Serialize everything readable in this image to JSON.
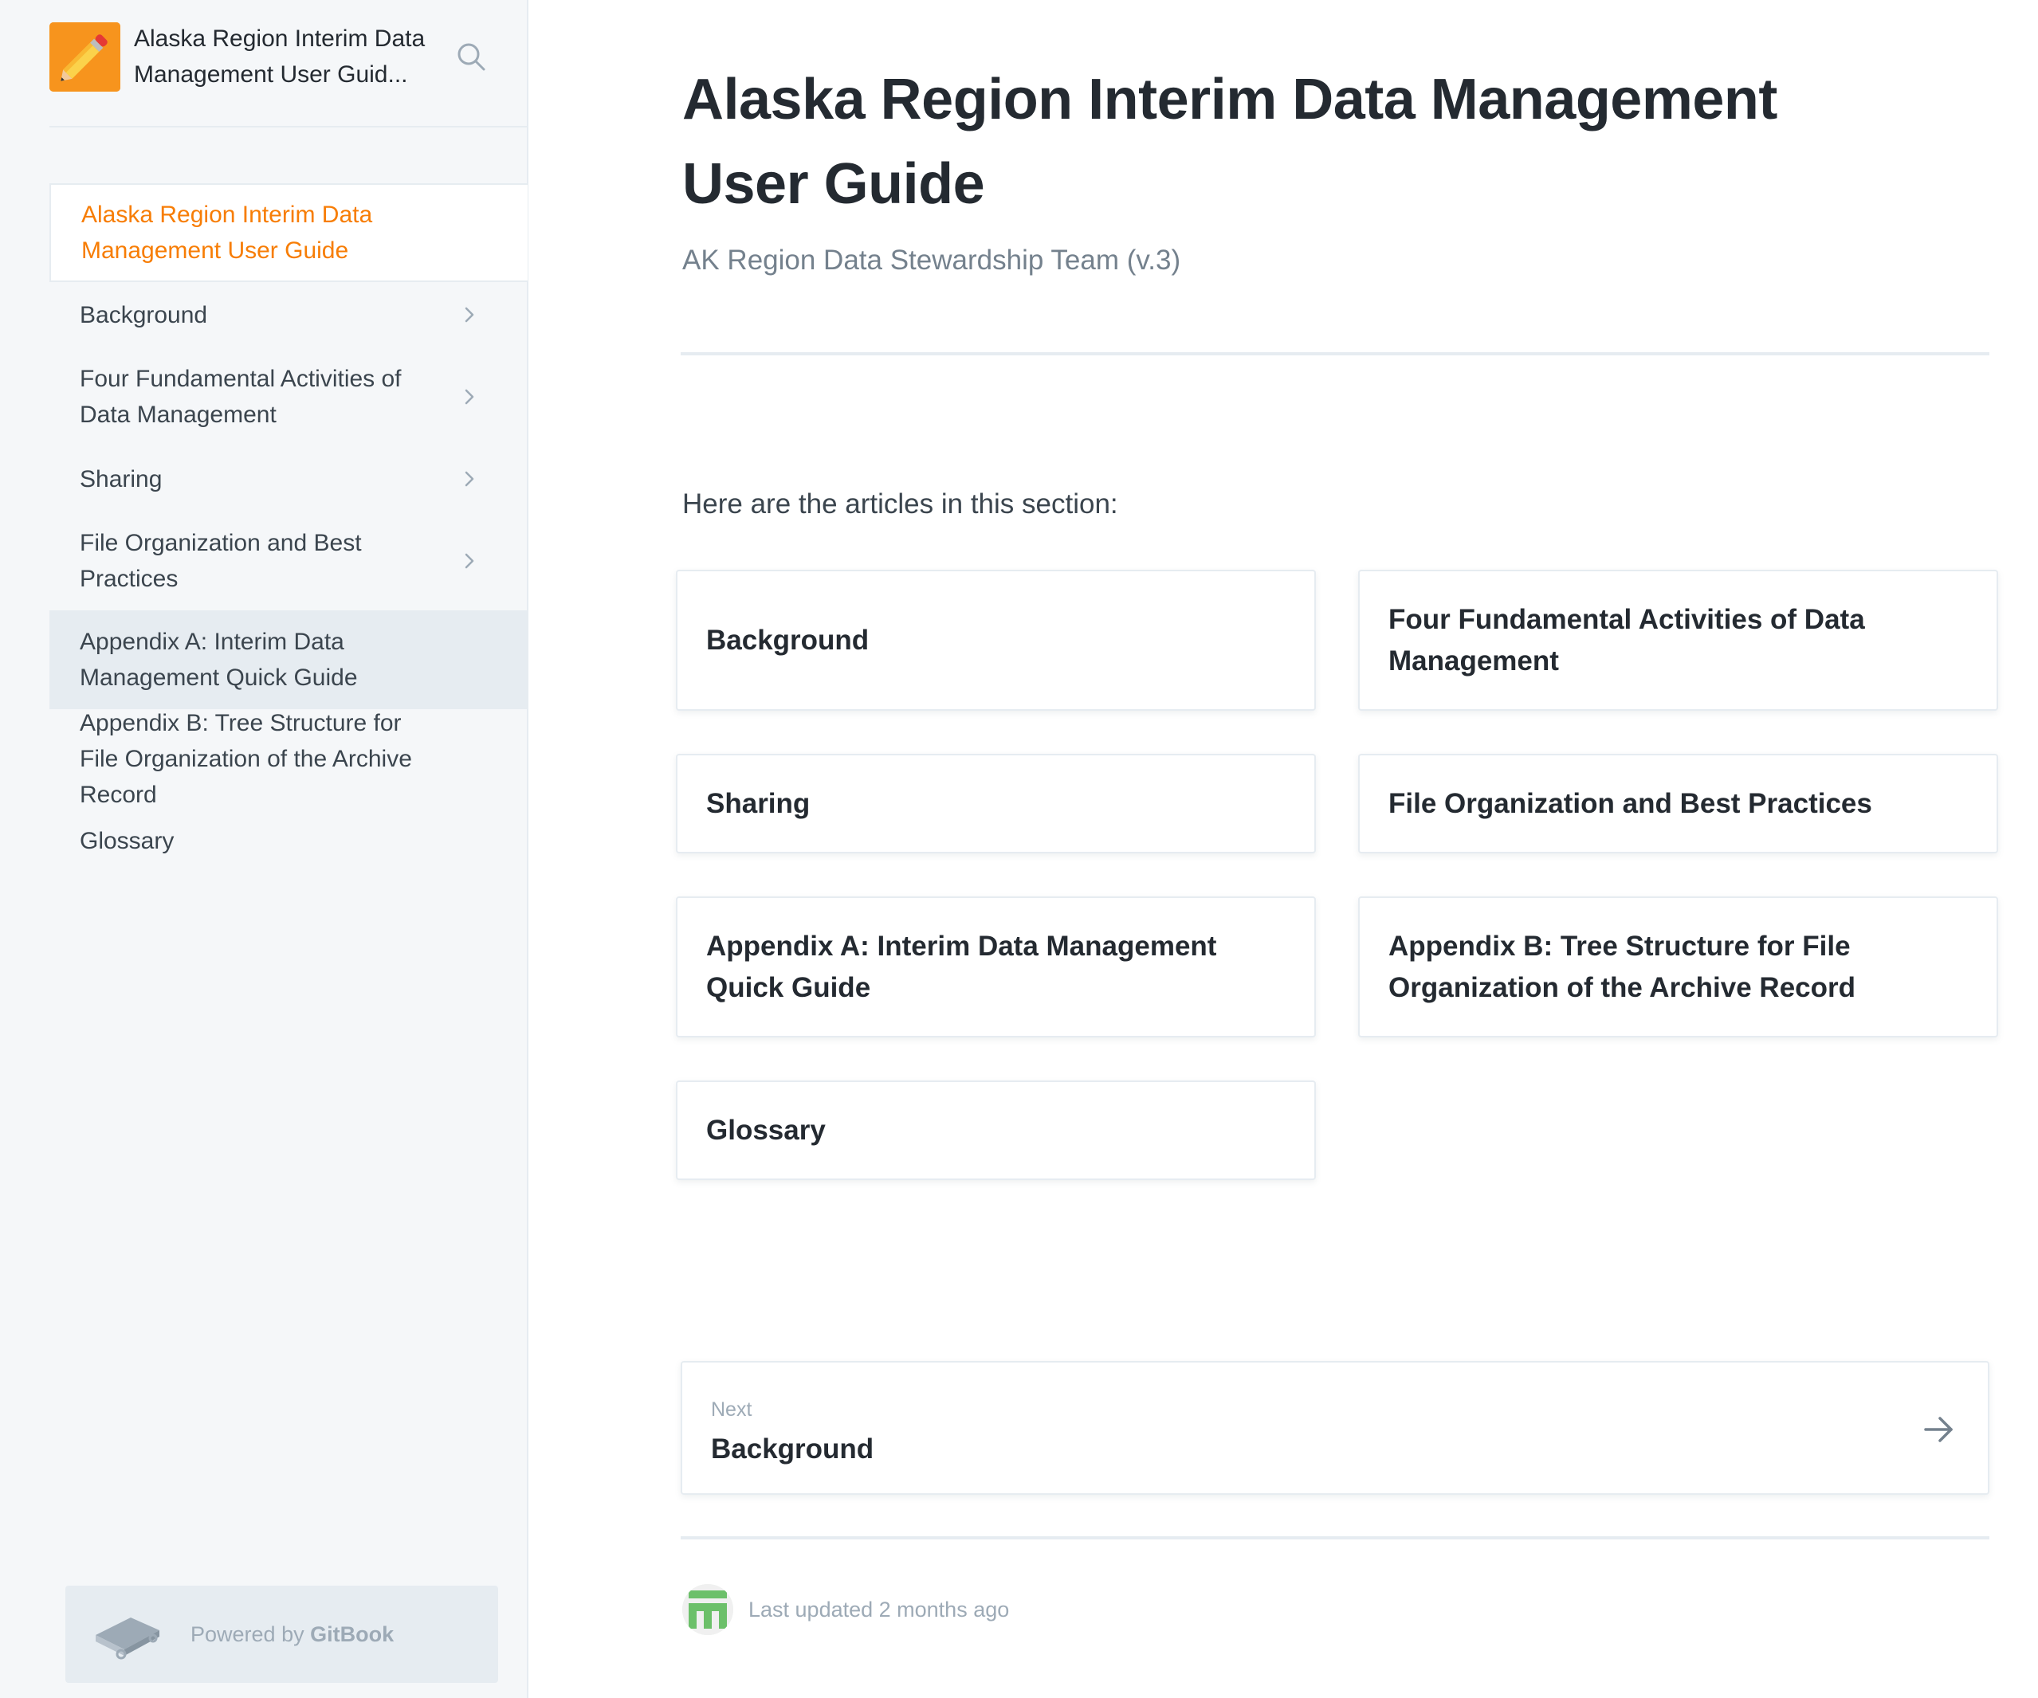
{
  "sidebar": {
    "title_line1": "Alaska Region Interim Data",
    "title_line2": "Management User Guid...",
    "items": [
      {
        "label": "Alaska Region Interim Data Management User Guide"
      },
      {
        "label": "Background"
      },
      {
        "label": "Four Fundamental Activities of Data Management"
      },
      {
        "label": "Sharing"
      },
      {
        "label": "File Organization and Best Practices"
      },
      {
        "label": "Appendix A: Interim Data Management Quick Guide"
      },
      {
        "label": "Appendix B: Tree Structure for File Organization of the Archive Record"
      },
      {
        "label": "Glossary"
      }
    ],
    "powered_prefix": "Powered by ",
    "powered_brand": "GitBook"
  },
  "main": {
    "title": "Alaska Region Interim Data Management User Guide",
    "subtitle": "AK Region Data Stewardship Team (v.3)",
    "intro": "Here are the articles in this section:",
    "cards": [
      {
        "label": "Background"
      },
      {
        "label": "Four Fundamental Activities of Data Management"
      },
      {
        "label": "Sharing"
      },
      {
        "label": "File Organization and Best Practices"
      },
      {
        "label": "Appendix A: Interim Data Management Quick Guide"
      },
      {
        "label": "Appendix B: Tree Structure for File Organization of the Archive Record"
      },
      {
        "label": "Glossary"
      }
    ],
    "next": {
      "label": "Next",
      "title": "Background"
    },
    "last_updated": "Last updated 2 months ago"
  },
  "colors": {
    "accent": "#f77d05",
    "sidebar_bg": "#f5f7f9",
    "border": "#e6ecf1",
    "text": "#242a31",
    "muted": "#9daab6"
  },
  "icons": {
    "logo": "pencil-icon",
    "search": "search-icon",
    "chevron": "chevron-right-icon",
    "next": "arrow-right-icon",
    "powered": "gitbook-icon"
  }
}
